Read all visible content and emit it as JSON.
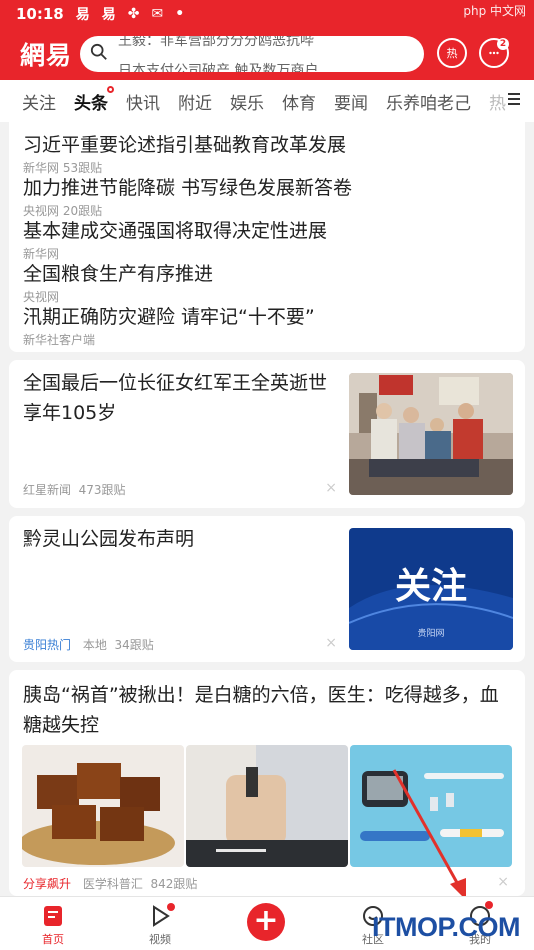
{
  "status": {
    "time": "10:18",
    "watermark_text": "php 中文网"
  },
  "header": {
    "logo": "網易",
    "search_hint_1": "王毅：非军营部分分分鸥恶抗哔",
    "search_hint_2": "日本支付公司破产 触及数万商户",
    "hot_label": "热",
    "msg_badge": "2"
  },
  "tabs": {
    "items": [
      {
        "label": "关注"
      },
      {
        "label": "头条"
      },
      {
        "label": "快讯"
      },
      {
        "label": "附近"
      },
      {
        "label": "娱乐"
      },
      {
        "label": "体育"
      },
      {
        "label": "要闻"
      },
      {
        "label": "乐养咱老己"
      },
      {
        "label": "热"
      }
    ]
  },
  "headlines": [
    {
      "title": "习近平重要论述指引基础教育改革发展",
      "meta": "新华网  53跟贴"
    },
    {
      "title": "加力推进节能降碳 书写绿色发展新答卷",
      "meta": "央视网  20跟贴"
    },
    {
      "title": "基本建成交通强国将取得决定性进展",
      "meta": "新华网"
    },
    {
      "title": "全国粮食生产有序推进",
      "meta": "央视网"
    },
    {
      "title": "汛期正确防灾避险 请牢记“十不要”",
      "meta": "新华社客户端"
    }
  ],
  "articles": [
    {
      "title": "全国最后一位长征女红军王全英逝世享年105岁",
      "source": "红星新闻",
      "follow": "473跟贴"
    },
    {
      "title": "黔灵山公园发布声明",
      "tag": "贵阳热门",
      "source": "本地",
      "follow": "34跟贴",
      "thumb_text": "关注",
      "thumb_sub": "贵阳网"
    },
    {
      "title": "胰岛“祸首”被揪出！是白糖的六倍，医生：吃得越多，血糖越失控",
      "tag": "分享飙升",
      "source": "医学科普汇",
      "follow": "842跟贴"
    }
  ],
  "close_label": "×",
  "bottom_nav": {
    "home": "首页",
    "video": "视频",
    "community": "社区",
    "me": "我的"
  },
  "watermark": "ITMOP.COM",
  "colors": {
    "brand": "#e8252b",
    "blue_tag": "#3a7fd5"
  }
}
